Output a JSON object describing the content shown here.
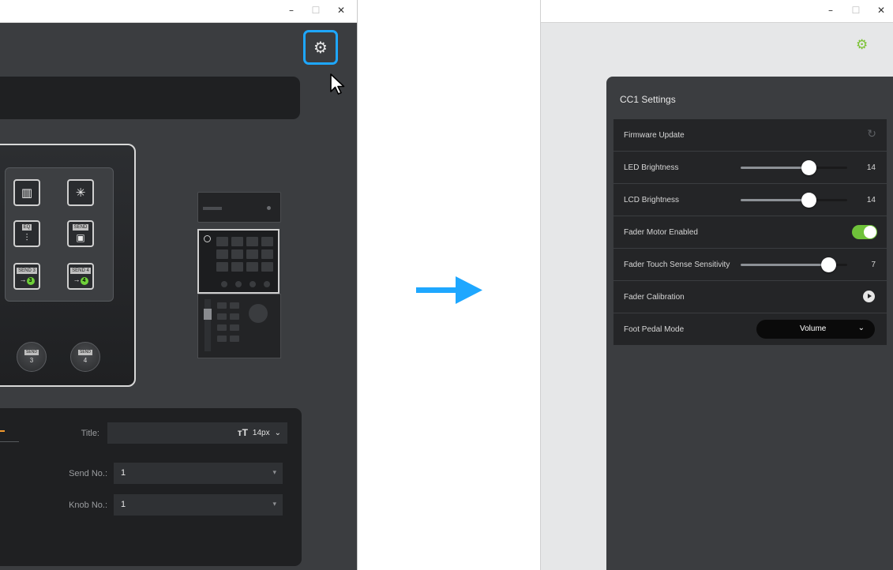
{
  "window_controls": {
    "minimize": "–",
    "maximize": "☐",
    "close": "✕"
  },
  "left_window": {
    "device_pads": [
      {
        "name": "piano-pad",
        "glyph": "▥",
        "tag": ""
      },
      {
        "name": "snowflake-pad",
        "glyph": "✳",
        "tag": ""
      },
      {
        "name": "eq-pad",
        "glyph": "⫶",
        "tag": "EQ"
      },
      {
        "name": "send-pad",
        "glyph": "▣",
        "tag": "SEND"
      },
      {
        "name": "send3-pad",
        "glyph": "→",
        "tag": "SEND 3",
        "num": "3"
      },
      {
        "name": "send4-pad",
        "glyph": "→",
        "tag": "SEND 4",
        "num": "4"
      }
    ],
    "knobs": [
      {
        "tag": "SEND",
        "num": "3"
      },
      {
        "tag": "SEND",
        "num": "4"
      }
    ],
    "properties": {
      "title_label": "Title:",
      "font_size": "14px",
      "font_icon": "тT",
      "send_no_label": "Send No.:",
      "send_no_value": "1",
      "knob_no_label": "Knob No.:",
      "knob_no_value": "1"
    }
  },
  "right_window": {
    "panel_title": "CC1 Settings",
    "rows": [
      {
        "label": "Firmware Update"
      },
      {
        "label": "LED Brightness",
        "value": "14",
        "level": 0.64
      },
      {
        "label": "LCD Brightness",
        "value": "14",
        "level": 0.64
      },
      {
        "label": "Fader Motor Enabled",
        "enabled": true
      },
      {
        "label": "Fader Touch Sense Sensitivity",
        "value": "7",
        "level": 0.82
      },
      {
        "label": "Fader Calibration"
      },
      {
        "label": "Foot Pedal Mode",
        "value": "Volume"
      }
    ]
  },
  "colors": {
    "accent_blue": "#1ea7ff",
    "accent_green": "#6fc23a",
    "panel_dark": "#3b3d40"
  }
}
